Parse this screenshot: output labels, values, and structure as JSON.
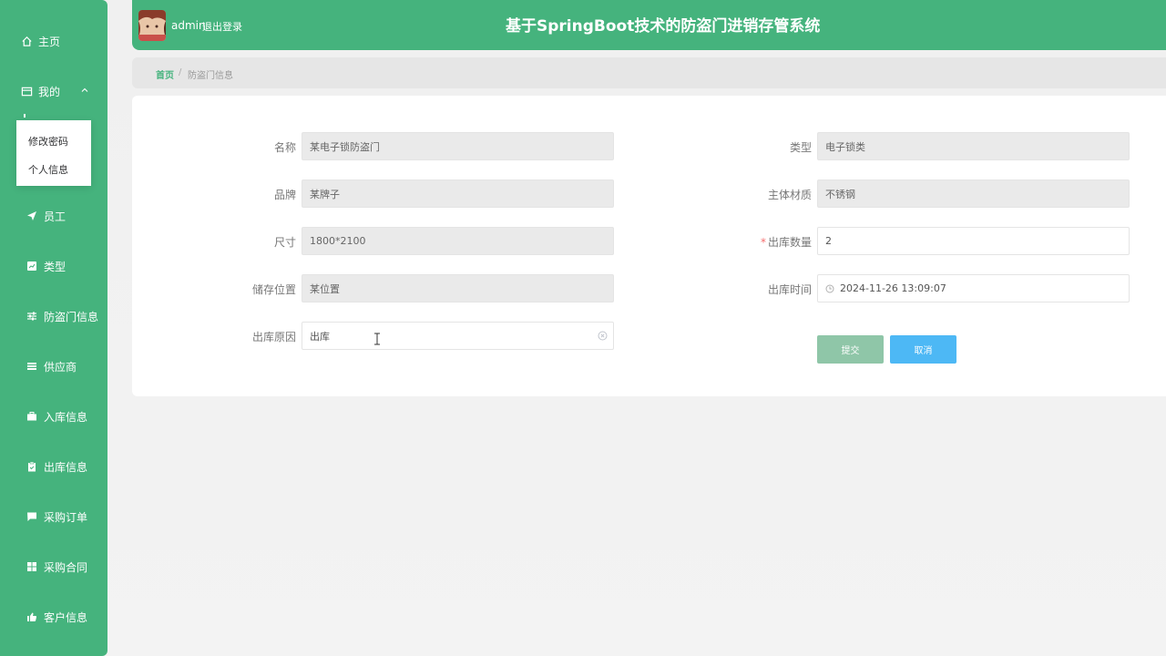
{
  "sidebar": {
    "home": "主页",
    "mine": "我的",
    "mine_submenu": [
      "修改密码",
      "个人信息"
    ],
    "items": [
      {
        "label": "员工",
        "icon": "send-icon"
      },
      {
        "label": "类型",
        "icon": "chart-box-icon"
      },
      {
        "label": "防盗门信息",
        "icon": "sliders-icon"
      },
      {
        "label": "供应商",
        "icon": "list-icon"
      },
      {
        "label": "入库信息",
        "icon": "briefcase-icon"
      },
      {
        "label": "出库信息",
        "icon": "clipboard-icon"
      },
      {
        "label": "采购订单",
        "icon": "chat-icon"
      },
      {
        "label": "采购合同",
        "icon": "grid-icon"
      },
      {
        "label": "客户信息",
        "icon": "thumb-icon"
      }
    ]
  },
  "header": {
    "username": "admin",
    "logout": "退出登录",
    "title": "基于SpringBoot技术的防盗门进销存管系统"
  },
  "breadcrumb": {
    "home": "首页",
    "separator": "/",
    "current": "防盗门信息"
  },
  "form": {
    "name_label": "名称",
    "name_value": "某电子锁防盗门",
    "type_label": "类型",
    "type_value": "电子锁类",
    "brand_label": "品牌",
    "brand_value": "某牌子",
    "material_label": "主体材质",
    "material_value": "不锈钢",
    "size_label": "尺寸",
    "size_value": "1800*2100",
    "qty_required": "*",
    "qty_label": "出库数量",
    "qty_value": "2",
    "location_label": "储存位置",
    "location_value": "某位置",
    "time_label": "出库时间",
    "time_value": "2024-11-26 13:09:07",
    "reason_label": "出库原因",
    "reason_value": "出库",
    "submit": "提交",
    "cancel": "取消"
  },
  "colors": {
    "primary": "#45b37d",
    "submit": "#8fc6a8",
    "cancel": "#4db8f5",
    "required": "#f56c6c"
  }
}
